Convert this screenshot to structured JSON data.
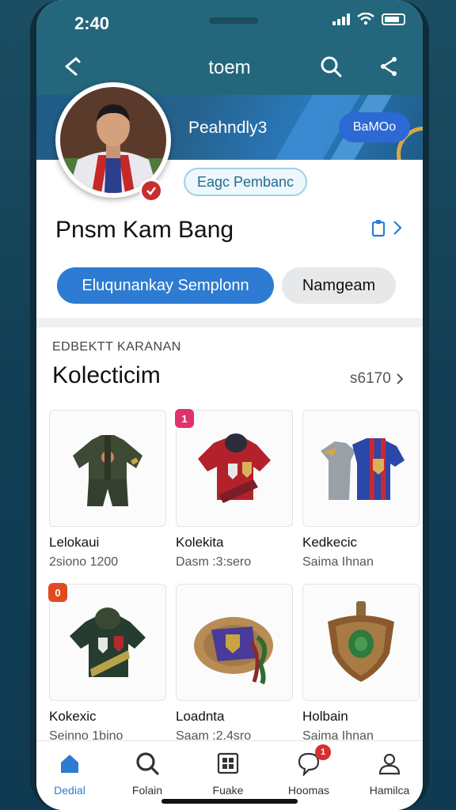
{
  "status_bar": {
    "time": "2:40"
  },
  "header": {
    "title": "toem"
  },
  "banner": {
    "name": "Peahndly3",
    "button_label": "BaMOo"
  },
  "profile": {
    "tag": "Eagc Pembanc",
    "name": "Pnsm Kam Bang",
    "primary_button": "Eluqunankay Semplonn",
    "secondary_button": "Namgeam"
  },
  "collection": {
    "subtitle": "EDBEKTT KARANAN",
    "title": "Kolecticim",
    "count": "s6170",
    "items": [
      {
        "title": "Lelokaui",
        "subtitle": "2siono 1200",
        "icon": "soldier-uniform-icon"
      },
      {
        "title": "Kolekita",
        "subtitle": "Dasm :3:sero",
        "icon": "red-jersey-icon",
        "badge": "1"
      },
      {
        "title": "Kedkecic",
        "subtitle": "Saima Ihnan",
        "icon": "football-shirts-icon"
      },
      {
        "title": "Kokexic",
        "subtitle": "Seinno 1bino",
        "icon": "green-jersey-icon",
        "badge": "0"
      },
      {
        "title": "Loadnta",
        "subtitle": "Saam :2.4sro",
        "icon": "rope-scarf-icon"
      },
      {
        "title": "Holbain",
        "subtitle": "Saima Ihnan",
        "icon": "shield-icon"
      }
    ]
  },
  "tabs": [
    {
      "label": "Dedial",
      "icon": "home-icon",
      "active": true
    },
    {
      "label": "Folain",
      "icon": "search-icon"
    },
    {
      "label": "Fuake",
      "icon": "grid-icon"
    },
    {
      "label": "Hoomas",
      "icon": "heart-chat-icon",
      "badge": "1"
    },
    {
      "label": "Hamilca",
      "icon": "profile-icon"
    }
  ],
  "colors": {
    "header_bg": "#24677d",
    "accent": "#2d7bd2",
    "badge_red": "#d62f2f"
  }
}
